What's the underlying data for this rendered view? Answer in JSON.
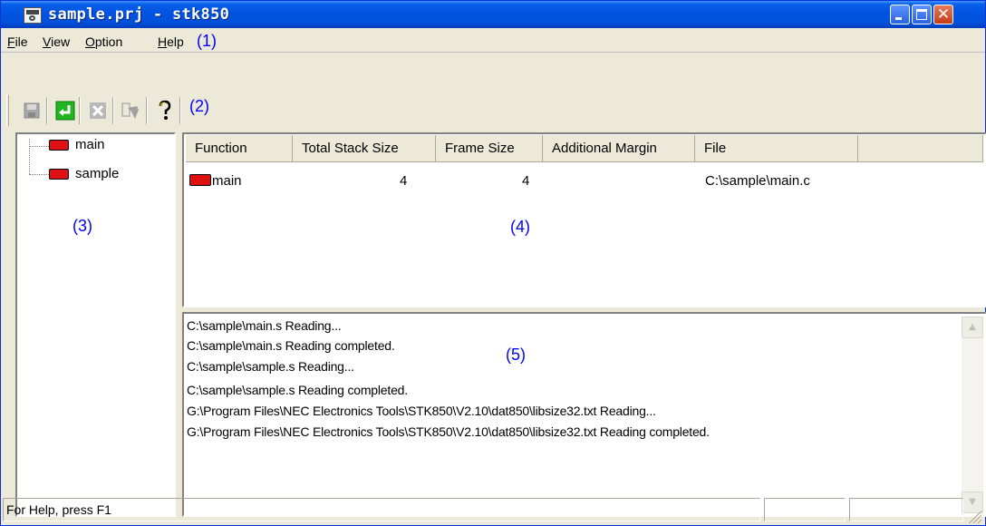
{
  "window": {
    "title": "sample.prj - stk850",
    "controls": [
      "minimize",
      "maximize",
      "close"
    ]
  },
  "menu": {
    "items": [
      {
        "label": "File",
        "accel": "F"
      },
      {
        "label": "View",
        "accel": "V"
      },
      {
        "label": "Option",
        "accel": "O"
      },
      {
        "label": "Help",
        "accel": "H"
      }
    ]
  },
  "callouts": {
    "menu": "(1)",
    "toolbar": "(2)",
    "tree": "(3)",
    "list": "(4)",
    "log": "(5)"
  },
  "toolbar": {
    "buttons": [
      {
        "icon": "save-icon",
        "enabled": false
      },
      {
        "icon": "enter-icon",
        "enabled": true
      },
      {
        "icon": "delete-icon",
        "enabled": false
      },
      {
        "icon": "search-tool-icon",
        "enabled": false
      },
      {
        "icon": "help-icon",
        "enabled": true
      }
    ]
  },
  "tree": {
    "items": [
      {
        "label": "main"
      },
      {
        "label": "sample"
      }
    ]
  },
  "table": {
    "columns": [
      "Function",
      "Total Stack Size",
      "Frame Size",
      "Additional Margin",
      "File"
    ],
    "rows": [
      {
        "function": "main",
        "total_stack_size": "4",
        "frame_size": "4",
        "additional_margin": "",
        "file": "C:\\sample\\main.c"
      }
    ]
  },
  "log": {
    "lines": [
      "C:\\sample\\main.s Reading...",
      "C:\\sample\\main.s Reading completed.",
      "C:\\sample\\sample.s Reading...",
      "C:\\sample\\sample.s Reading completed.",
      "G:\\Program Files\\NEC Electronics Tools\\STK850\\V2.10\\dat850\\libsize32.txt Reading...",
      "G:\\Program Files\\NEC Electronics Tools\\STK850\\V2.10\\dat850\\libsize32.txt Reading completed."
    ]
  },
  "status": {
    "text": "For Help, press F1"
  },
  "colors": {
    "title_bar": "#0054e3",
    "callout": "#0000ff",
    "function_icon": "#dd1111"
  }
}
